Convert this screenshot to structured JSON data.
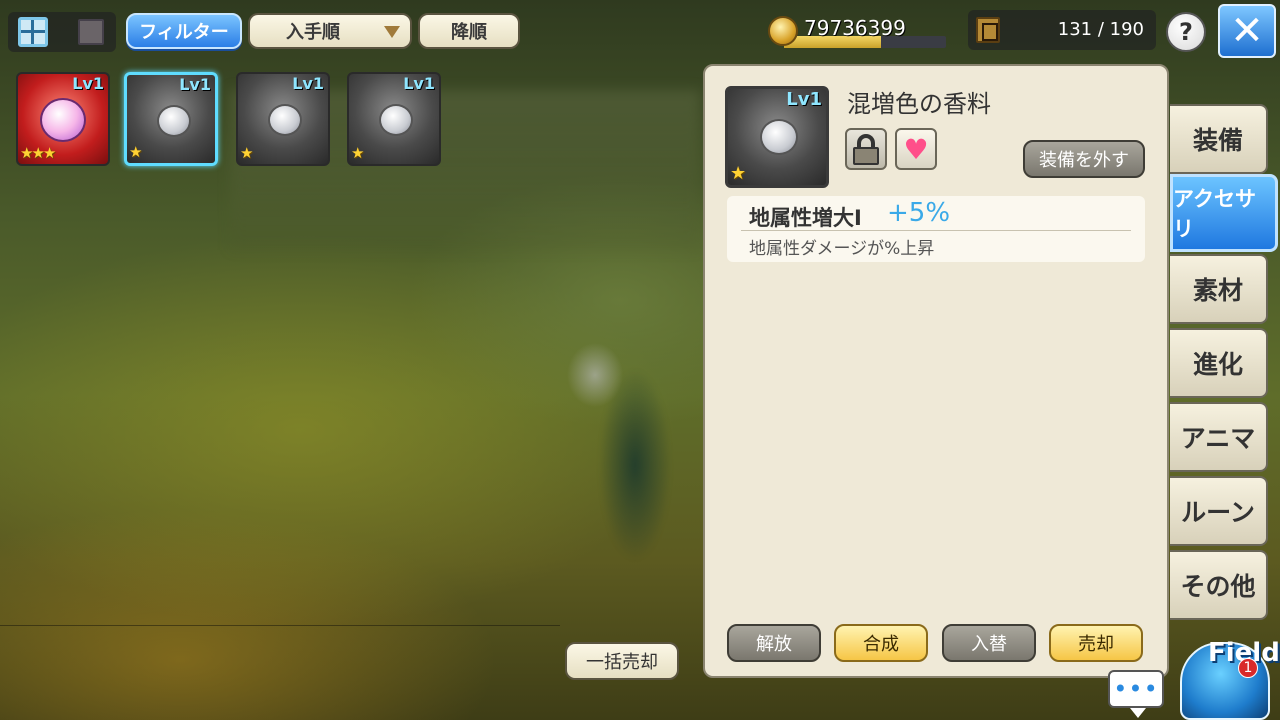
{
  "toolbar": {
    "filter_label": "フィルター",
    "sort_label": "入手順",
    "order_label": "降順"
  },
  "currency": {
    "gold": "79736399",
    "gold_bar_fill": 0.6
  },
  "inventory": {
    "count": "131 / 190"
  },
  "help_label": "?",
  "items": [
    {
      "level": "Lv1",
      "stars": "★★★",
      "rarity": "red"
    },
    {
      "level": "Lv1",
      "stars": "★",
      "rarity": "gray",
      "selected": true
    },
    {
      "level": "Lv1",
      "stars": "★",
      "rarity": "gray"
    },
    {
      "level": "Lv1",
      "stars": "★",
      "rarity": "gray"
    }
  ],
  "detail": {
    "level": "Lv1",
    "stars": "★",
    "name": "混増色の香料",
    "unequip_label": "装備を外す",
    "effect_name": "地属性増大Ⅰ",
    "effect_value": "+5%",
    "effect_description": "地属性ダメージが%上昇",
    "actions": {
      "release": "解放",
      "synthesize": "合成",
      "swap": "入替",
      "sell": "売却"
    }
  },
  "sell_all_label": "一括売却",
  "tabs": [
    {
      "label": "装備"
    },
    {
      "label": "アクセサリ",
      "active": true
    },
    {
      "label": "素材"
    },
    {
      "label": "進化"
    },
    {
      "label": "アニマ"
    },
    {
      "label": "ルーン"
    },
    {
      "label": "その他"
    }
  ],
  "field": {
    "label": "Field",
    "badge": "1"
  },
  "chat_label": "•••",
  "colors": {
    "accent_blue": "#2b7ee6",
    "panel_bg": "#efe9d7",
    "effect_value": "#3aa9e8",
    "button_yellow": "#f6c646"
  }
}
